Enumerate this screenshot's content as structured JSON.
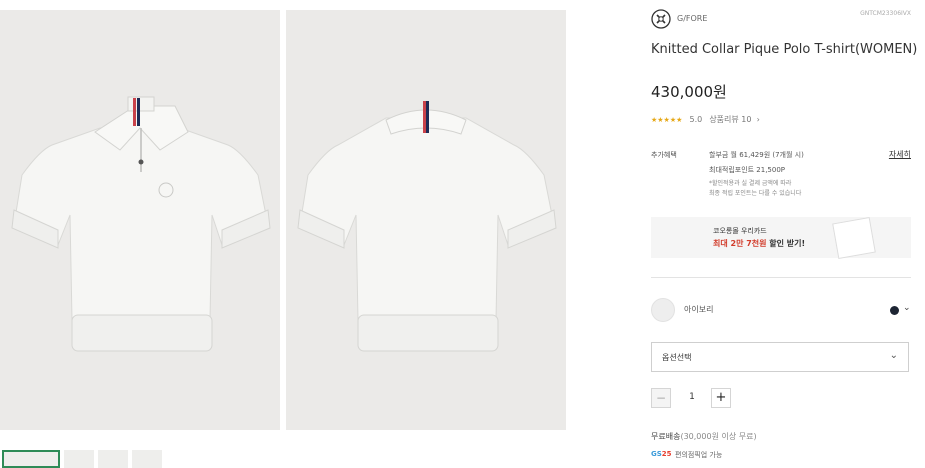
{
  "brand": {
    "name": "G/FORE",
    "product_code": "GNTCM23306IVX"
  },
  "product": {
    "title": "Knitted Collar Pique Polo T-shirt(WOMEN)",
    "price": "430,000원",
    "rating": {
      "stars": "★★★★★",
      "score": "5.0",
      "reviews_label": "상품리뷰 10",
      "chevron": "›",
      "value": 5.0,
      "max": 5
    }
  },
  "benefits": {
    "label": "추가혜택",
    "installment": "할부금 월 61,429원 (7개월 시)",
    "points": "최대적립포인트 21,500P",
    "note_line1": "*할인적용과 실 결제 금액에 따라",
    "note_line2": "최종 적립 포인트는 다를 수 있습니다",
    "detail_link": "자세히"
  },
  "card_banner": {
    "line1": "코오롱몰 우리카드",
    "line2_highlight": "최대 2만 7천원",
    "line2_rest": " 할인 받기!"
  },
  "color": {
    "label": "아이보리",
    "selected_dot_color": "#1d2533",
    "chevron": "⌄"
  },
  "option": {
    "placeholder": "옵션선택",
    "chevron": "⌄"
  },
  "quantity": {
    "minus": "−",
    "value": "1",
    "plus": "+"
  },
  "shipping": {
    "text": "무료배송",
    "sub": "(30,000원 이상 무료)",
    "gs_g": "GS",
    "gs_n": "25",
    "gs_text": "편의점픽업 가능"
  },
  "icons": {
    "brand_logo": "gfore-logo-icon",
    "detail": "chevron-right-icon"
  }
}
